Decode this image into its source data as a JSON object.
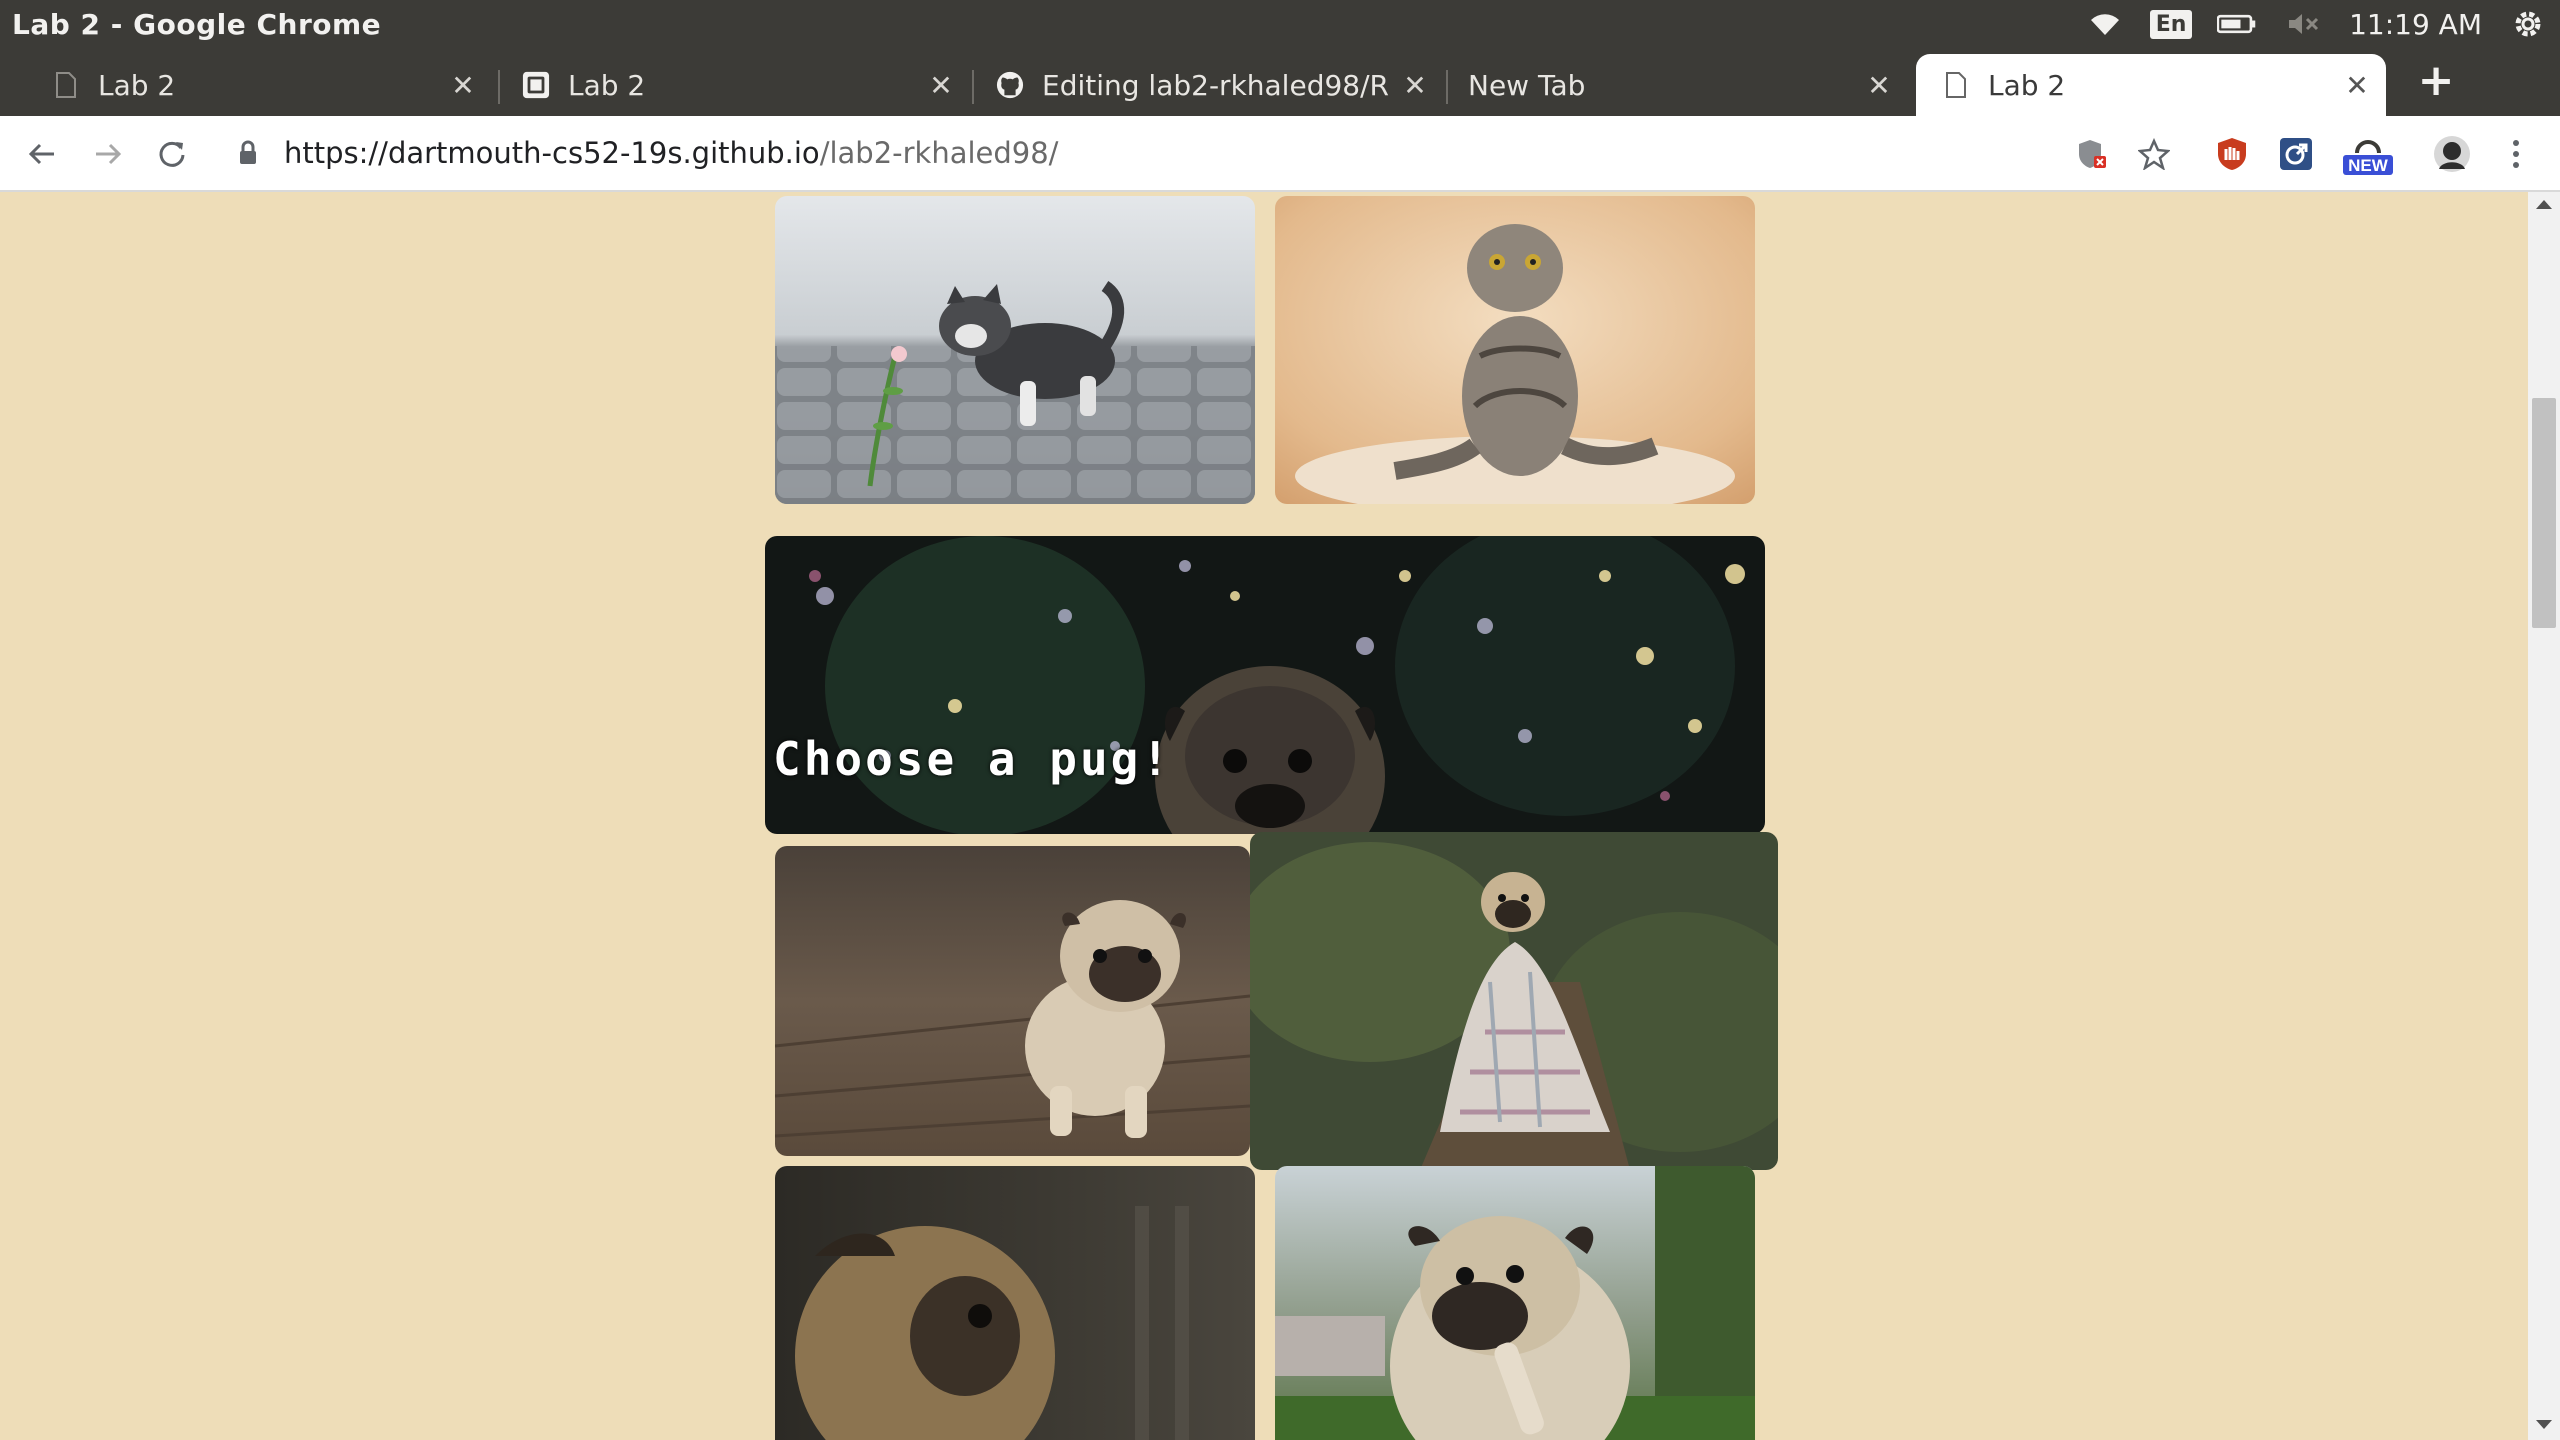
{
  "window": {
    "title": "Lab 2 - Google Chrome"
  },
  "tray": {
    "language": "En",
    "time": "11:19 AM"
  },
  "tabs": [
    {
      "label": "Lab 2",
      "icon": "page-icon"
    },
    {
      "label": "Lab 2",
      "icon": "site-icon"
    },
    {
      "label": "Editing lab2-rkhaled98/R",
      "icon": "github-icon"
    },
    {
      "label": "New Tab",
      "icon": ""
    },
    {
      "label": "Lab 2",
      "icon": "page-icon",
      "active": true
    }
  ],
  "toolbar": {
    "url_host": "https://dartmouth-cs52-19s.github.io",
    "url_path": "/lab2-rkhaled98/",
    "ext_new_badge": "NEW"
  },
  "page": {
    "background": "#eeddb8",
    "banner_text": "Choose a pug!",
    "images": [
      "kitten-with-flower",
      "scottish-fold-cat",
      "pug-christmas-banner",
      "pug-puppy-on-floor",
      "pug-in-blanket",
      "pug-in-shadow",
      "pug-chewing-bone"
    ]
  },
  "colors": {
    "titlebar": "#3c3b37",
    "page_bg": "#eeddb8",
    "scroll_thumb": "#c1c1c1"
  }
}
